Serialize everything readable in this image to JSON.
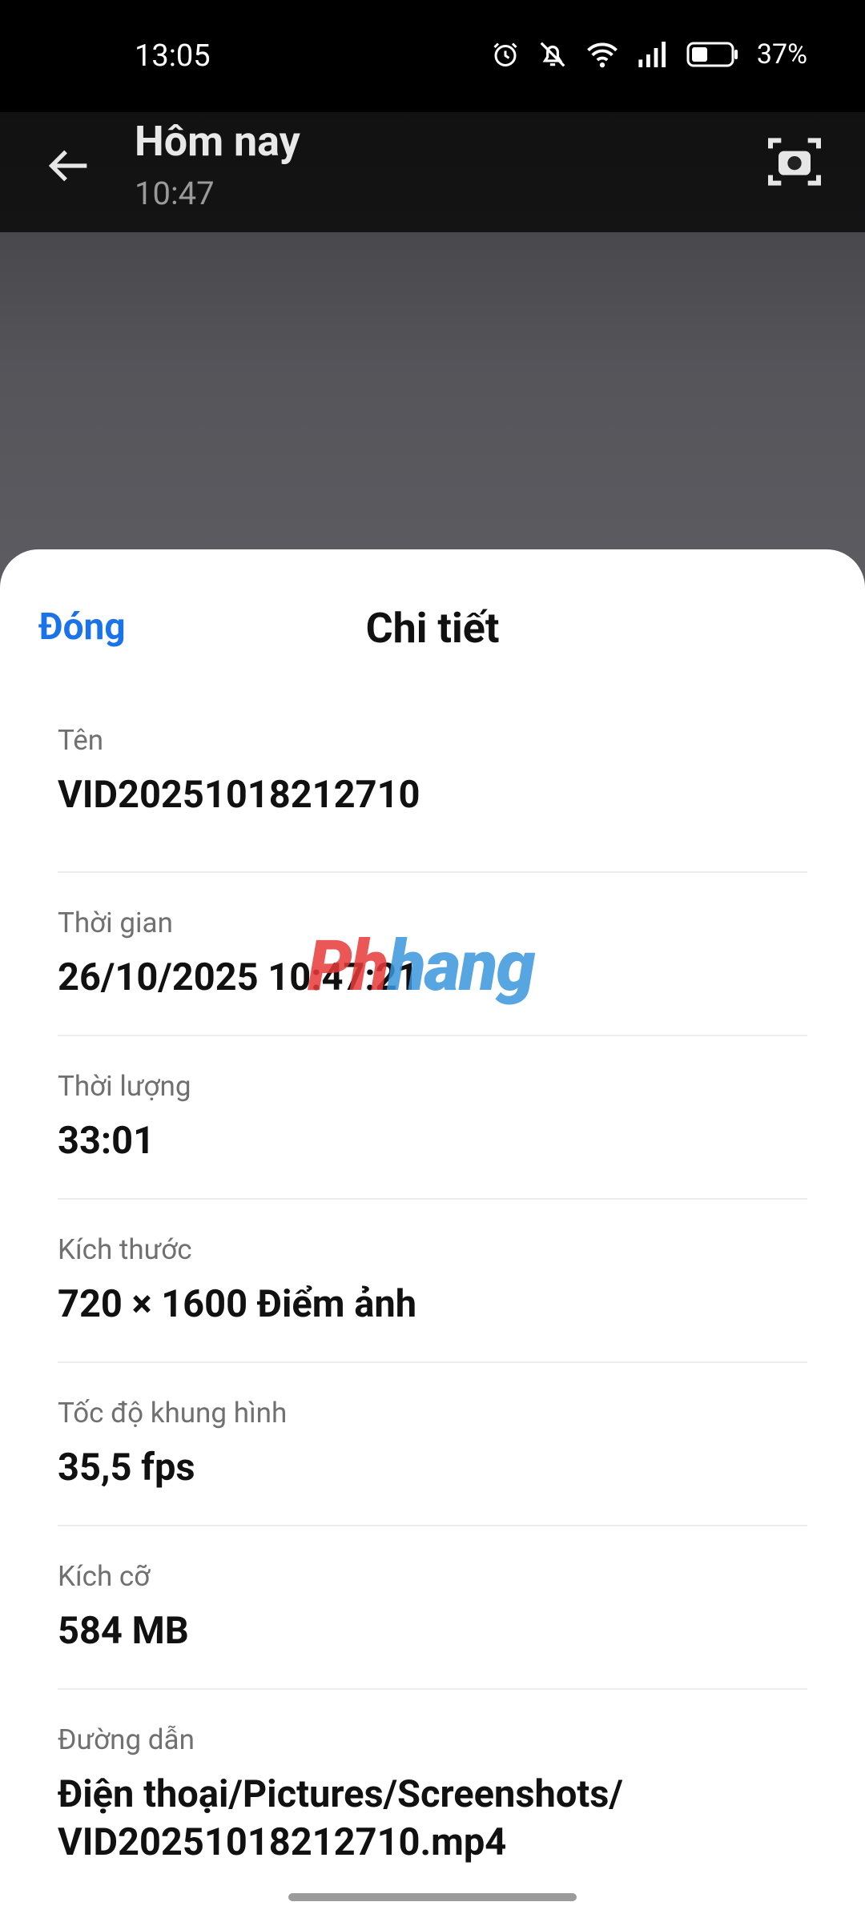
{
  "status_bar": {
    "time": "13:05",
    "battery_percent": "37%",
    "battery_level": 0.37,
    "icons": [
      "alarm-icon",
      "silent-icon",
      "wifi-icon",
      "signal-icon",
      "battery-icon"
    ]
  },
  "header": {
    "title": "Hôm nay",
    "subtitle": "10:47",
    "back_icon": "arrow-left-icon",
    "camera_icon": "camera-icon"
  },
  "media": {
    "note": ""
  },
  "sheet": {
    "close_label": "Đóng",
    "title": "Chi tiết",
    "rows": [
      {
        "label": "Tên",
        "value": "VID20251018212710"
      },
      {
        "label": "Thời gian",
        "value": "26/10/2025 10:47:21"
      },
      {
        "label": "Thời lượng",
        "value": "33:01"
      },
      {
        "label": "Kích thước",
        "value": "720 × 1600 Điểm ảnh"
      },
      {
        "label": "Tốc độ khung hình",
        "value": "35,5 fps"
      },
      {
        "label": "Kích cỡ",
        "value": "584 MB"
      },
      {
        "label": "Đường dẫn",
        "value_line1": "Điện thoại/Pictures/Screenshots/",
        "value_line2": "VID20251018212710.mp4"
      }
    ]
  },
  "watermark": {
    "part_a": "Ph",
    "part_b": "hang"
  },
  "colors": {
    "accent": "#1a73e8",
    "text": "#111111",
    "label": "#707070"
  }
}
